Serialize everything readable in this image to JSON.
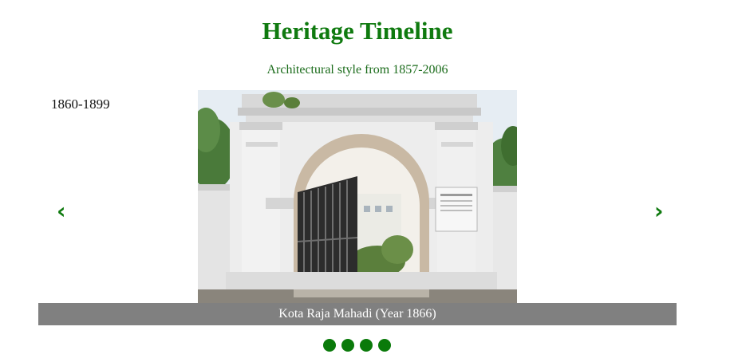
{
  "header": {
    "title": "Heritage Timeline",
    "subtitle": "Architectural style from 1857-2006"
  },
  "slide": {
    "period": "1860-1899",
    "caption": "Kota Raja Mahadi (Year 1866)",
    "image_description_icon": "gate-photo"
  },
  "navigation": {
    "prev_symbol": "‹",
    "next_symbol": "›"
  },
  "indicators": {
    "count": 4
  },
  "colors": {
    "accent": "#0f7a0f",
    "caption_bg": "#808080"
  }
}
